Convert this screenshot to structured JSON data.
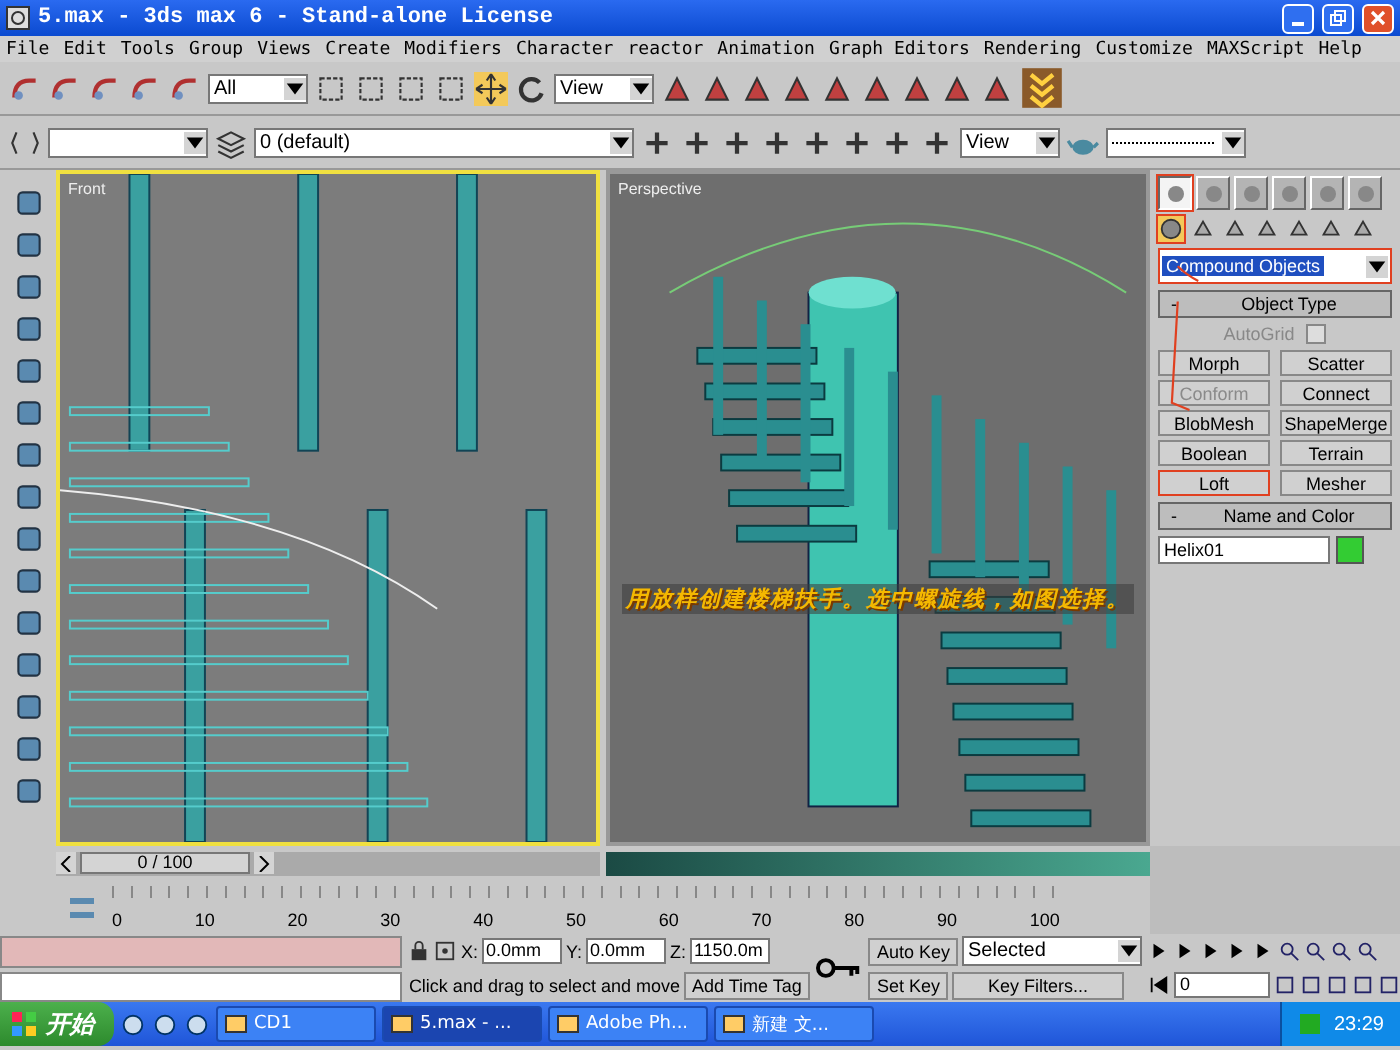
{
  "window": {
    "title": "5.max - 3ds max 6 - Stand-alone License"
  },
  "menu": [
    "File",
    "Edit",
    "Tools",
    "Group",
    "Views",
    "Create",
    "Modifiers",
    "Character",
    "reactor",
    "Animation",
    "Graph Editors",
    "Rendering",
    "Customize",
    "MAXScript",
    "Help"
  ],
  "toolbar": {
    "selection_filter": "All",
    "reference_coord": "View"
  },
  "toolbar2": {
    "layer": "0 (default)",
    "render_view": "View"
  },
  "viewports": [
    {
      "label": "Front",
      "kind": "front",
      "active": true
    },
    {
      "label": "Perspective",
      "kind": "perspective",
      "active": false
    }
  ],
  "caption": "用放样创建楼梯扶手。选中螺旋线，如图选择。",
  "command_panel": {
    "tabs": [
      {
        "selected": true
      },
      {
        "selected": false
      },
      {
        "selected": false
      },
      {
        "selected": false
      },
      {
        "selected": false
      },
      {
        "selected": false
      }
    ],
    "category": "Compound Objects",
    "object_type": {
      "collapse": "-",
      "title": "Object Type",
      "autogrid": {
        "label": "AutoGrid",
        "checked": false
      },
      "buttons": [
        {
          "label": "Morph",
          "disabled": false,
          "selected": false
        },
        {
          "label": "Scatter",
          "disabled": false,
          "selected": false
        },
        {
          "label": "Conform",
          "disabled": true,
          "selected": false
        },
        {
          "label": "Connect",
          "disabled": false,
          "selected": false
        },
        {
          "label": "BlobMesh",
          "disabled": false,
          "selected": false
        },
        {
          "label": "ShapeMerge",
          "disabled": false,
          "selected": false
        },
        {
          "label": "Boolean",
          "disabled": false,
          "selected": false
        },
        {
          "label": "Terrain",
          "disabled": false,
          "selected": false
        },
        {
          "label": "Loft",
          "disabled": false,
          "selected": true
        },
        {
          "label": "Mesher",
          "disabled": false,
          "selected": false
        }
      ]
    },
    "name_color": {
      "collapse": "-",
      "title": "Name and Color",
      "name": "Helix01",
      "color": "#33cc33"
    }
  },
  "time_slider": {
    "label": "0 / 100"
  },
  "ruler_labels": [
    "0",
    "10",
    "20",
    "30",
    "40",
    "50",
    "60",
    "70",
    "80",
    "90",
    "100"
  ],
  "status": {
    "x_label": "X:",
    "x": "0.0mm",
    "y_label": "Y:",
    "y": "0.0mm",
    "z_label": "Z:",
    "z": "1150.0m",
    "auto_key": "Auto Key",
    "key_mode": "Selected",
    "set_key": "Set Key",
    "key_filters": "Key Filters...",
    "frame": "0",
    "prompt": "Click and drag to select and move",
    "time_tag": "Add Time Tag"
  },
  "taskbar": {
    "start": "开始",
    "tasks": [
      {
        "label": "CD1",
        "selected": false
      },
      {
        "label": "5.max - ...",
        "selected": true
      },
      {
        "label": "Adobe Ph...",
        "selected": false
      },
      {
        "label": "新建 文...",
        "selected": false
      }
    ],
    "clock": "23:29"
  }
}
